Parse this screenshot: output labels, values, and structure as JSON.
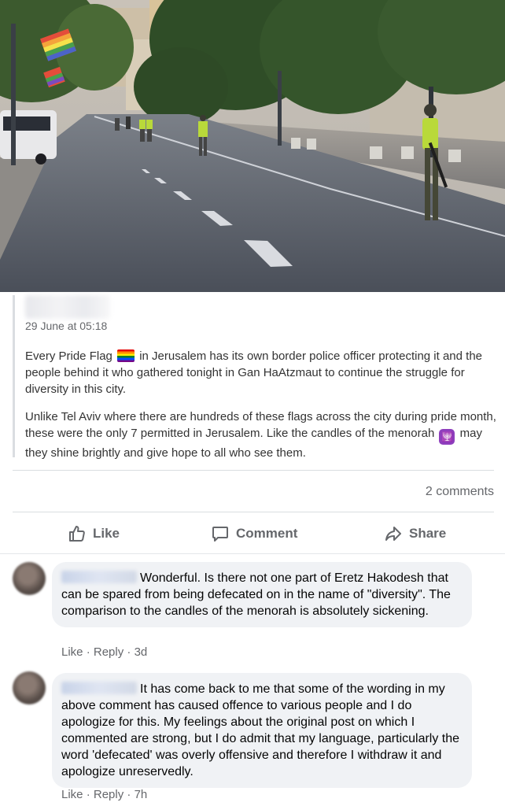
{
  "post": {
    "timestamp": "29 June at 05:18",
    "paragraph1_before": "Every Pride Flag",
    "paragraph1_after": "in Jerusalem has its own border police officer protecting it and the people behind it who gathered tonight in Gan HaAtzmaut to continue the struggle for diversity in this city.",
    "paragraph2_before": "Unlike Tel Aviv where there are hundreds of these flags across the city during pride month, these were the only 7 permitted in Jerusalem. Like the candles of the menorah",
    "paragraph2_after": "may they shine brightly and give hope to all who see them.",
    "emoji_1": "rainbow-flag-icon",
    "emoji_2": "menorah-icon",
    "menorah_glyph": "🕎",
    "comments_count": "2 comments"
  },
  "actions": {
    "like_label": "Like",
    "comment_label": "Comment",
    "share_label": "Share"
  },
  "comments": [
    {
      "text": "Wonderful. Is there not one part of Eretz Hakodesh that can be spared from being defecated on in the name of \"diversity\". The comparison to the candles of the menorah is absolutely sickening.",
      "like": "Like",
      "reply": "Reply",
      "separator": "·",
      "time": "3d"
    },
    {
      "text": "It has come back to me that some of the wording in my above comment has caused offence to various people and I do apologize for this. My feelings about the original post on which I commented are strong, but I do admit that my language, particularly the word 'defecated' was overly offensive and therefore I withdraw it and apologize unreservedly.",
      "like": "Like",
      "reply": "Reply",
      "separator": "·",
      "time": "7h"
    }
  ],
  "colors": {
    "secondary_text": "#65676b",
    "bubble_bg": "#f0f2f5",
    "divider": "#dadde1"
  }
}
